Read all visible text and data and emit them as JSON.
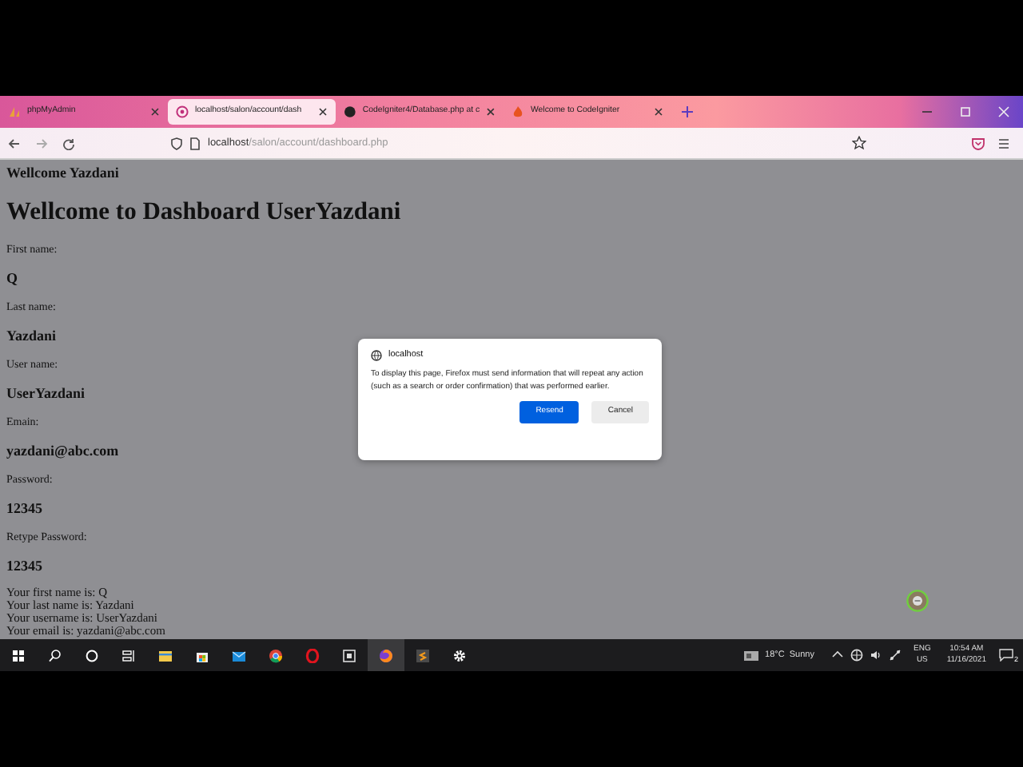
{
  "browser": {
    "tabs": [
      {
        "title": "phpMyAdmin",
        "selected": false
      },
      {
        "title": "localhost/salon/account/dash",
        "selected": true
      },
      {
        "title": "CodeIgniter4/Database.php at c",
        "selected": false
      },
      {
        "title": "Welcome to CodeIgniter",
        "selected": false
      }
    ],
    "address": {
      "host": "localhost",
      "path": "/salon/account/dashboard.php"
    }
  },
  "page": {
    "greeting": "Wellcome Yazdani",
    "heading": "Wellcome to Dashboard UserYazdani",
    "fields": [
      {
        "label": "First name:",
        "value": "Q"
      },
      {
        "label": "Last name:",
        "value": "Yazdani"
      },
      {
        "label": "User name:",
        "value": "UserYazdani"
      },
      {
        "label": "Emain:",
        "value": "yazdani@abc.com"
      },
      {
        "label": "Password:",
        "value": "12345"
      },
      {
        "label": "Retype Password:",
        "value": "12345"
      }
    ],
    "summary": [
      "Your first name is: Q",
      "Your last name is: Yazdani",
      "Your username is: UserYazdani",
      "Your email is: yazdani@abc.com"
    ]
  },
  "dialog": {
    "origin": "localhost",
    "message": "To display this page, Firefox must send information that will repeat any action (such as a search or order confirmation) that was performed earlier.",
    "buttons": [
      {
        "label": "Resend",
        "primary": true
      },
      {
        "label": "Cancel",
        "primary": false
      }
    ]
  },
  "taskbar": {
    "weather": "18°C  Sunny",
    "language": "ENG",
    "region": "US",
    "time": "10:54 AM",
    "date": "11/16/2021",
    "notifications": "2"
  }
}
